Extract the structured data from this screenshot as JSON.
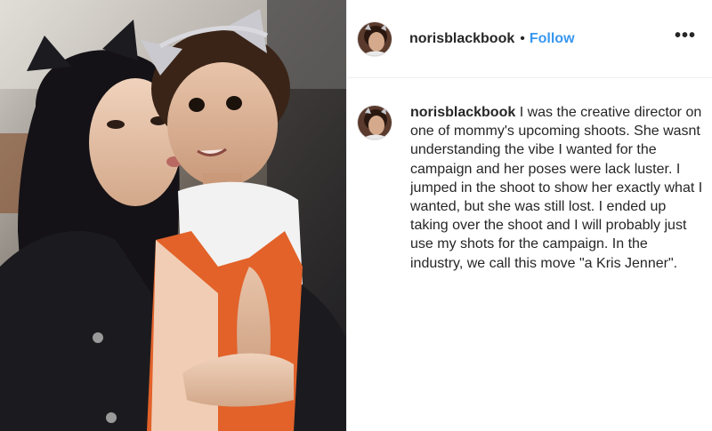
{
  "post": {
    "username": "norisblackbook",
    "separator": "•",
    "follow_label": "Follow",
    "more_label": "•••",
    "caption": {
      "username": "norisblackbook",
      "text": "I was the creative director on one of mommy's upcoming shoots. She wasnt understanding the vibe I wanted for the campaign and her poses were lack luster. I jumped in the shoot to show her exactly what I wanted, but she was still lost. I ended up taking over the shoot and I will probably just use my shots for the campaign. In the industry, we call this move \"a Kris Jenner\"."
    }
  },
  "icons": {
    "more": "more-options-icon",
    "avatar": "profile-avatar"
  },
  "colors": {
    "follow": "#3897f0",
    "text": "#262626",
    "divider": "#efefef"
  }
}
